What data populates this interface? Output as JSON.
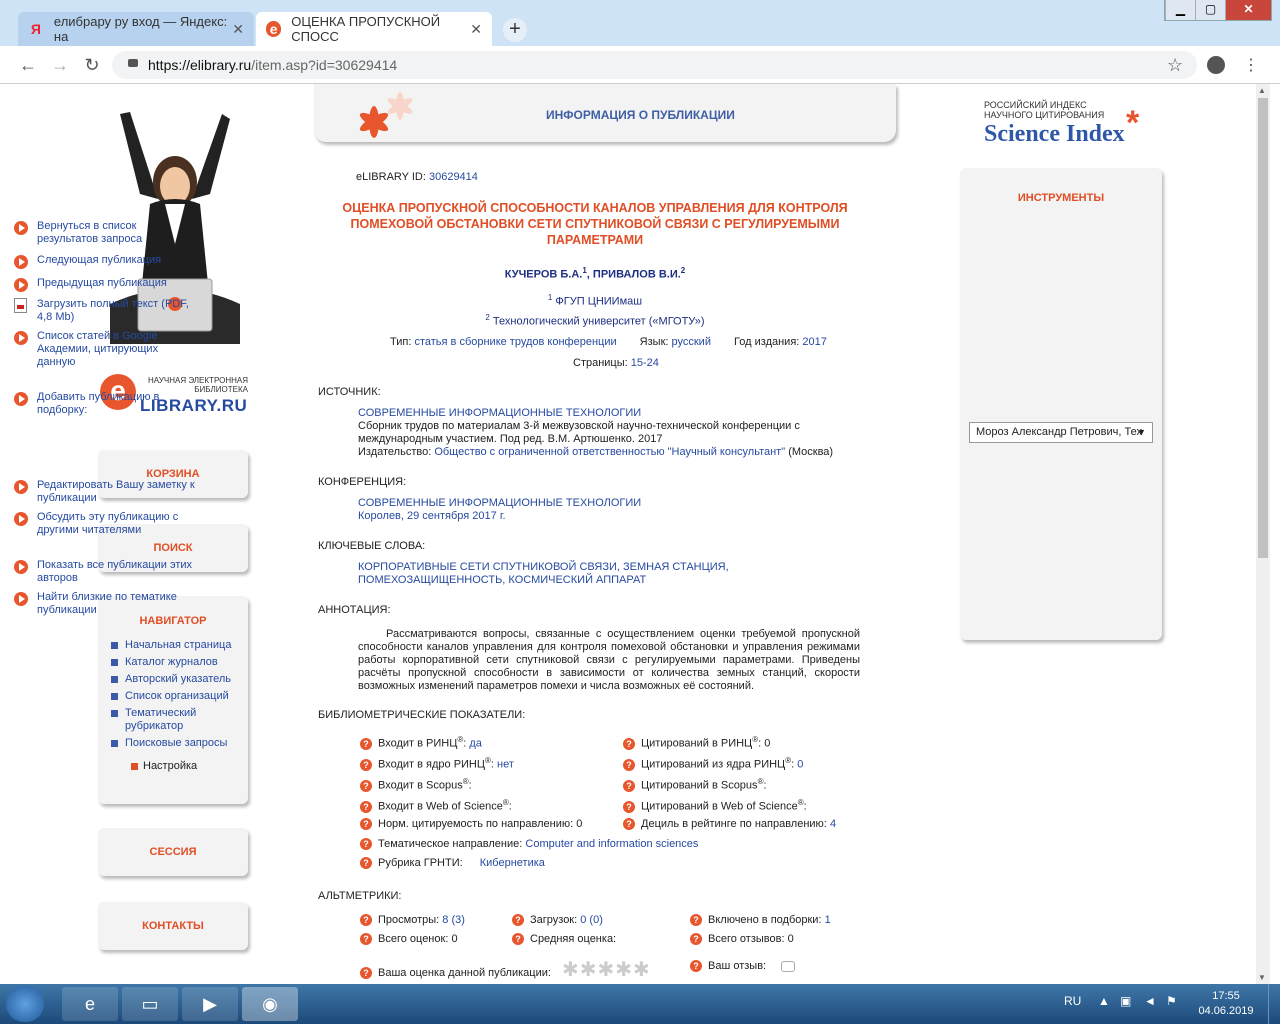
{
  "browser": {
    "tabs": [
      {
        "label": "елибрару ру вход — Яндекс: на",
        "favicon": "Я"
      },
      {
        "label": "ОЦЕНКА ПРОПУСКНОЙ СПОСС",
        "favicon": "e"
      }
    ],
    "new_tab": "+",
    "url_host": "https://elibrary.ru",
    "url_path": "/item.asp?id=30629414"
  },
  "left": {
    "logo_small": "НАУЧНАЯ ЭЛЕКТРОННАЯ БИБЛИОТЕКА",
    "logo_big": "LIBRARY.RU",
    "cart": "КОРЗИНА",
    "search": "ПОИСК",
    "navigator": {
      "title": "НАВИГАТОР",
      "items": [
        "Начальная страница",
        "Каталог журналов",
        "Авторский указатель",
        "Список организаций",
        "Тематический рубрикатор",
        "Поисковые запросы"
      ],
      "settings": "Настройка"
    },
    "session": "СЕССИЯ",
    "contacts": "КОНТАКТЫ"
  },
  "header": {
    "title": "ИНФОРМАЦИЯ О ПУБЛИКАЦИИ"
  },
  "pub": {
    "id_label": "eLIBRARY ID:",
    "id": "30629414",
    "title": "ОЦЕНКА ПРОПУСКНОЙ СПОСОБНОСТИ КАНАЛОВ УПРАВЛЕНИЯ ДЛЯ КОНТРОЛЯ ПОМЕХОВОЙ ОБСТАНОВКИ СЕТИ СПУТНИКОВОЙ СВЯЗИ С РЕГУЛИРУЕМЫМИ ПАРАМЕТРАМИ",
    "author1": "КУЧЕРОВ Б.А.",
    "author2": "ПРИВАЛОВ В.И.",
    "sup1": "1",
    "sup2": "2",
    "affil1": "ФГУП ЦНИИмаш",
    "affil2": "Технологический университет («МГОТУ»)",
    "type_label": "Тип:",
    "type": "статья в сборнике трудов конференции",
    "lang_label": "Язык:",
    "lang": "русский",
    "year_label": "Год издания:",
    "year": "2017",
    "pages_label": "Страницы:",
    "pages": "15-24",
    "source_label": "ИСТОЧНИК:",
    "source_title": "СОВРЕМЕННЫЕ ИНФОРМАЦИОННЫЕ ТЕХНОЛОГИИ",
    "source_desc": "Сборник трудов по материалам 3-й межвузовской научно-технической конференции с международным участием. Под ред. В.М. Артюшенко. 2017",
    "publisher_label": "Издательство:",
    "publisher": "Общество с ограниченной ответственностью \"Научный консультант\"",
    "publisher_city": "(Москва)",
    "conf_label": "КОНФЕРЕНЦИЯ:",
    "conf_title": "СОВРЕМЕННЫЕ ИНФОРМАЦИОННЫЕ ТЕХНОЛОГИИ",
    "conf_place": "Королев, 29 сентября 2017 г.",
    "kw_label": "КЛЮЧЕВЫЕ СЛОВА:",
    "keywords": "КОРПОРАТИВНЫЕ СЕТИ СПУТНИКОВОЙ СВЯЗИ, ЗЕМНАЯ СТАНЦИЯ, ПОМЕХОЗАЩИЩЕННОСТЬ, КОСМИЧЕСКИЙ АППАРАТ",
    "ann_label": "АННОТАЦИЯ:",
    "annotation": "Рассматриваются вопросы, связанные с осуществлением оценки требуемой пропускной способности каналов управления для контроля помеховой обстановки и управления режимами работы корпоративной сети спутниковой связи с регулируемыми параметрами. Приведены расчёты пропускной способности в зависимости от количества земных станций, скорости возможных изменений параметров помехи и числа возможных её состояний."
  },
  "biblio": {
    "label": "БИБЛИОМЕТРИЧЕСКИЕ ПОКАЗАТЕЛИ:",
    "rinc_in": "Входит в РИНЦ",
    "rinc_in_v": "да",
    "rinc_core": "Входит в ядро РИНЦ",
    "rinc_core_v": "нет",
    "scopus_in": "Входит в Scopus",
    "wos_in": "Входит в Web of Science",
    "norm": "Норм. цитируемость по направлению:",
    "norm_v": "0",
    "theme": "Тематическое направление:",
    "theme_v": "Computer and information sciences",
    "grnti": "Рубрика ГРНТИ:",
    "grnti_v": "Кибернетика",
    "cit_rinc": "Цитирований в РИНЦ",
    "cit_rinc_v": "0",
    "cit_core": "Цитирований из ядра РИНЦ",
    "cit_core_v": "0",
    "cit_scopus": "Цитирований в Scopus",
    "cit_wos": "Цитирований в Web of Science",
    "decile": "Дециль в рейтинге по направлению:",
    "decile_v": "4",
    "reg": "®",
    "colon": ":"
  },
  "alt": {
    "label": "АЛЬТМЕТРИКИ:",
    "views": "Просмотры:",
    "views_v": "8 (3)",
    "downloads": "Загрузок:",
    "downloads_v": "0 (0)",
    "collections": "Включено в подборки:",
    "collections_v": "1",
    "ratings": "Всего оценок:",
    "ratings_v": "0",
    "avg": "Средняя оценка:",
    "reviews": "Всего отзывов:",
    "reviews_v": "0",
    "your_rating": "Ваша оценка данной публикации:",
    "your_review": "Ваш отзыв:",
    "stars": "✱✱✱✱✱"
  },
  "right": {
    "si_line1": "РОССИЙСКИЙ ИНДЕКС",
    "si_line2": "НАУЧНОГО ЦИТИРОВАНИЯ",
    "si_big": "Science Index",
    "tools_title": "ИНСТРУМЕНТЫ",
    "tools": [
      "Вернуться в список результатов запроса",
      "Следующая публикация",
      "Предыдущая публикация",
      "Загрузить полный текст (PDF, 4,8 Mb)",
      "Список статей в Google Академии, цитирующих данную",
      "Добавить публикацию в подборку:",
      "Редактировать Вашу заметку к публикации",
      "Обсудить эту публикацию с другими читателями",
      "Показать все публикации этих авторов",
      "Найти близкие по тематике публикации"
    ],
    "select_value": "Мороз Александр Петрович, Тех"
  },
  "taskbar": {
    "lang": "RU",
    "time": "17:55",
    "date": "04.06.2019"
  }
}
